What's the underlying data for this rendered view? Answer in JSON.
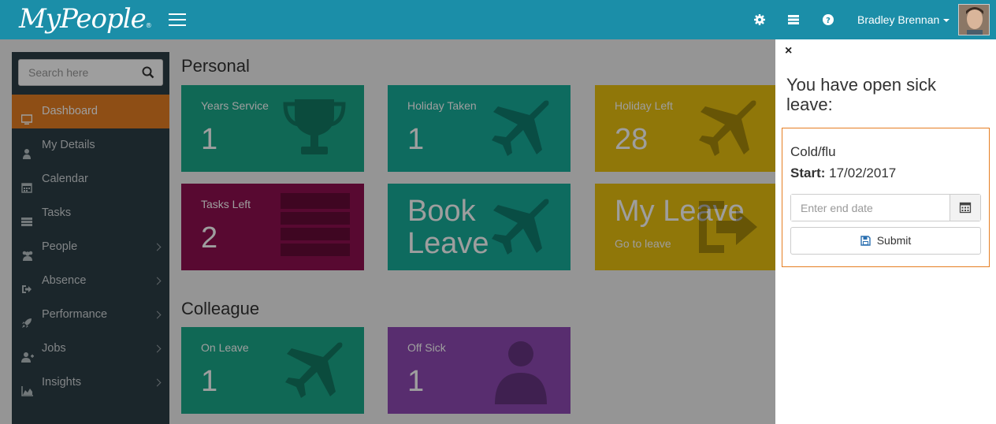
{
  "app": {
    "logo": "MyPeople",
    "logo_mark": "®"
  },
  "header": {
    "user_name": "Bradley Brennan"
  },
  "search": {
    "placeholder": "Search here"
  },
  "sidebar": {
    "items": [
      {
        "label": "Dashboard",
        "icon": "monitor-icon",
        "active": true
      },
      {
        "label": "My Details",
        "icon": "user-icon"
      },
      {
        "label": "Calendar",
        "icon": "calendar-icon"
      },
      {
        "label": "Tasks",
        "icon": "tasks-icon"
      },
      {
        "label": "People",
        "icon": "people-icon",
        "has_submenu": true
      },
      {
        "label": "Absence",
        "icon": "sign-out-icon",
        "has_submenu": true
      },
      {
        "label": "Performance",
        "icon": "rocket-icon",
        "has_submenu": true
      },
      {
        "label": "Jobs",
        "icon": "user-plus-icon",
        "has_submenu": true
      },
      {
        "label": "Insights",
        "icon": "area-chart-icon",
        "has_submenu": true
      }
    ]
  },
  "personal": {
    "title": "Personal",
    "tiles": {
      "years_service": {
        "label": "Years Service",
        "value": "1"
      },
      "holiday_taken": {
        "label": "Holiday Taken",
        "value": "1"
      },
      "holiday_left": {
        "label": "Holiday Left",
        "value": "28"
      },
      "tasks_left": {
        "label": "Tasks Left",
        "value": "2"
      },
      "book_leave": {
        "line1": "Book",
        "line2": "Leave"
      },
      "my_leave": {
        "title": "My Leave",
        "sub": "Go to leave"
      }
    }
  },
  "colleague": {
    "title": "Colleague",
    "tiles": {
      "on_leave": {
        "label": "On Leave",
        "value": "1"
      },
      "off_sick": {
        "label": "Off Sick",
        "value": "1"
      }
    }
  },
  "sick_panel": {
    "close": "×",
    "title": "You have open sick leave:",
    "leave_type": "Cold/flu",
    "start_label": "Start:",
    "start_date": "17/02/2017",
    "end_date_placeholder": "Enter end date",
    "submit_label": "Submit"
  },
  "colors": {
    "header": "#1b8ea8",
    "sidebar": "#2d3e46",
    "active": "#e67e22",
    "green": "#1aa98a",
    "yellow": "#e8c00f",
    "maroon": "#8f0f4f",
    "purple": "#8f4ab4"
  }
}
